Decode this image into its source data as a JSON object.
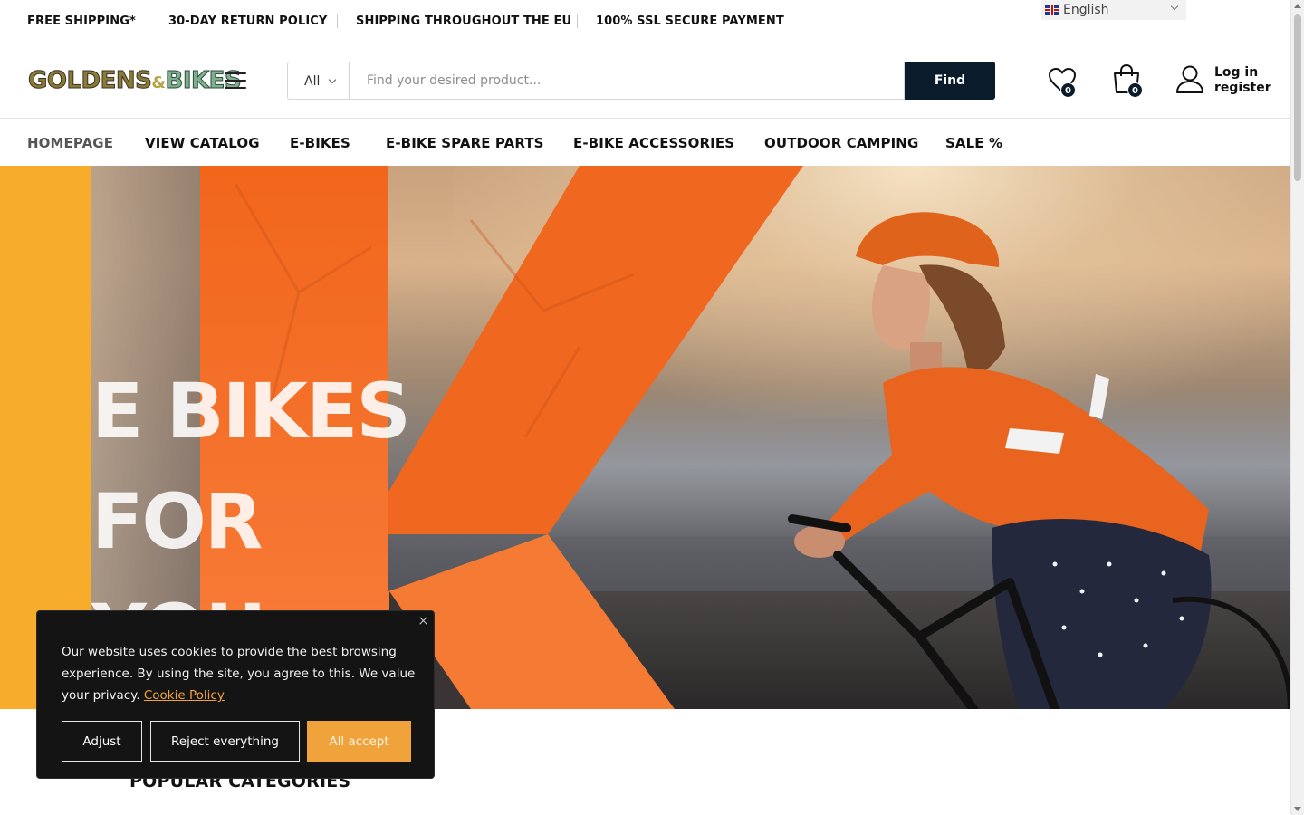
{
  "topbar": {
    "usps": [
      "FREE SHIPPING*",
      "30-DAY RETURN POLICY",
      "SHIPPING THROUGHOUT THE EU",
      "100% SSL SECURE PAYMENT"
    ],
    "language": {
      "label": "English",
      "flag": "uk-flag-icon"
    }
  },
  "header": {
    "logo": {
      "part1": "GOLDENS",
      "mid": "&",
      "part2": "BIKES"
    },
    "search": {
      "category": "All",
      "placeholder": "Find your desired product...",
      "button": "Find"
    },
    "wishlist_count": "0",
    "cart_count": "0",
    "account": {
      "login": "Log in",
      "register": "register"
    }
  },
  "nav": {
    "items": [
      "HOMEPAGE",
      "VIEW CATALOG",
      "E-BIKES",
      "E-BIKE SPARE PARTS",
      "E-BIKE ACCESSORIES",
      "OUTDOOR CAMPING",
      "SALE %"
    ]
  },
  "hero": {
    "lines": [
      "E BIKES",
      "FOR",
      "YOU"
    ]
  },
  "sections": {
    "popular_title": "POPULAR CATEGORIES"
  },
  "cookie": {
    "message": "Our website uses cookies to provide the best browsing experience. By using the site, you agree to this. We value your privacy.",
    "link": "Cookie Policy",
    "adjust": "Adjust",
    "reject": "Reject everything",
    "accept": "All accept"
  },
  "colors": {
    "accent_orange": "#f2661c",
    "strip_yellow": "#f7ac2b",
    "button_dark": "#0a1c2b",
    "cookie_accept": "#f0a23b"
  }
}
